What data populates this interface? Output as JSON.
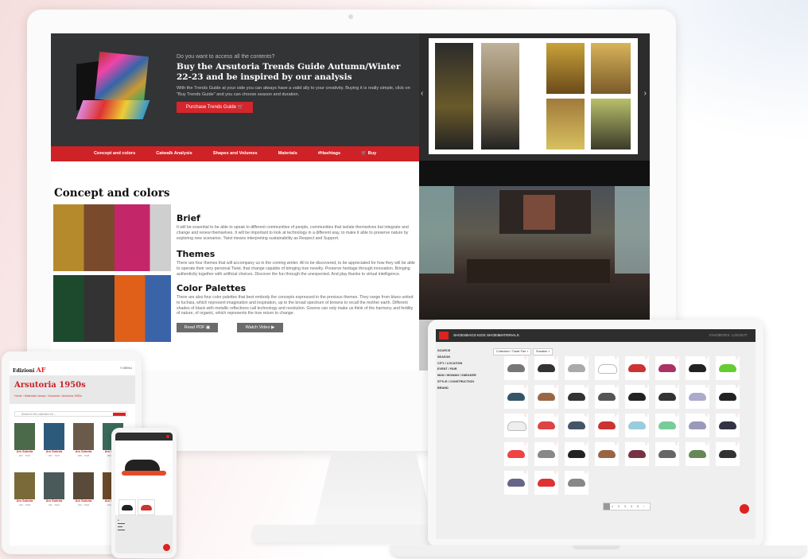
{
  "monitor": {
    "hero": {
      "question": "Do you want to access all the contents?",
      "headline": "Buy the Arsutoria Trends Guide Autumn/Winter 22-23 and be inspired by our analysis",
      "paragraph": "With the Trends Guide at your side you can always have a valid ally to your creativity. Buying it is really simple, click on \"Buy Trends Guide\" and you can choose season and duration.",
      "button": "Purchase Trends Guide",
      "button_icon": "cart-icon"
    },
    "nav": [
      "Concept and colors",
      "Catwalk Analysis",
      "Shapes and Volumes",
      "Materials",
      "#Hashtags",
      "Buy"
    ],
    "content": {
      "title": "Concept and colors",
      "brief_h": "Brief",
      "brief_t": "It will be essential to be able to speak to different communities of people, communities that isolate themselves but integrate and change and renew themselves. It will be important to look at technology in a different way, to make it able to preserve nature by exploring new scenarios. Twist means interpreting sustainability as Respect and Support.",
      "themes_h": "Themes",
      "themes_t": "There are four themes that will accompany us in the coming winter. All to be discovered, to be appreciated for how they will be able to operate their very personal Twist, that change capable of bringing true novelty. Preserve heritage through innovation. Bringing authenticity together with artificial choices. Discover the fun through the unexpected. And play thanks to virtual intelligence.",
      "palettes_h": "Color Palettes",
      "palettes_t": "There are also four color palettes that best embody the concepts expressed in the previous themes. They range from blues united to fuchsia, which represent imagination and inspiration, up to the broad spectrum of browns to recall the mother earth. Different shades of black with metallic reflections call technology and revolution. Greens can only make us think of the harmony and fertility of nature, of organic, which represents the true return to change.",
      "read_pdf": "Read PDF",
      "watch_video": "Watch Video"
    }
  },
  "laptop": {
    "nav": [
      "SHOES",
      "BAGS",
      "KIDS SHOES",
      "MATERIALS"
    ],
    "nav_right": [
      "FAVORITES",
      "LOGOUT"
    ],
    "sidebar": [
      "SOURCE",
      "SEASON",
      "CITY / LOCATION",
      "EVENT / FAIR",
      "MAN / WOMAN / SNEAKER",
      "STYLE / CONSTRUCTION",
      "BRAND"
    ],
    "chips": [
      "Collection / Trade Fair",
      "Sneaker"
    ],
    "pager": [
      "1",
      "2",
      "3",
      "4",
      "5",
      "›"
    ],
    "shoe_colors": [
      "#777",
      "#333",
      "#aaa",
      "#fff",
      "#c33",
      "#a36",
      "#222",
      "#6c3",
      "#356",
      "#964",
      "#333",
      "#555",
      "#222",
      "#333",
      "#aac",
      "#222",
      "#eee",
      "#d44",
      "#456",
      "#c33",
      "#9cd",
      "#7c9",
      "#99b",
      "#334",
      "#e44",
      "#888",
      "#222",
      "#964",
      "#734",
      "#666",
      "#685",
      "#333",
      "#668",
      "#d33",
      "#888"
    ]
  },
  "tablet": {
    "logo": "Edizioni",
    "logo_mark": "AF",
    "menu": "≡ MENU",
    "title": "Arsutoria 1950s",
    "breadcrumb": "Home › Materials Library › Arsutoria › Arsutoria 1950s",
    "search_placeholder": "Search in the collection for ...",
    "item_name": "Ars Sutoria",
    "item_codes": [
      "007 - 7627",
      "007 - 7627",
      "008 - 7628",
      "009 - 7629",
      "010 - 7630",
      "011 - 7631",
      "012 - 7632",
      "013 - 7633"
    ]
  }
}
